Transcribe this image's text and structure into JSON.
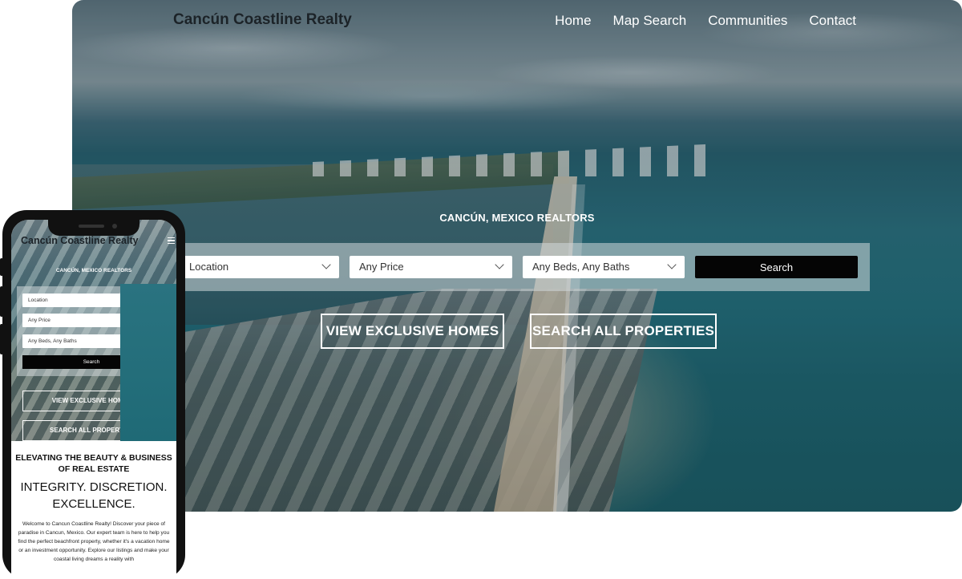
{
  "desktop": {
    "logo": "Cancún Coastline Realty",
    "nav": [
      "Home",
      "Map Search",
      "Communities",
      "Contact"
    ],
    "tagline": "CANCÚN, MEXICO REALTORS",
    "search": {
      "location": "Location",
      "price": "Any Price",
      "beds_baths": "Any Beds, Any Baths",
      "button": "Search"
    },
    "cta_exclusive": "VIEW EXCLUSIVE HOMES",
    "cta_all": "SEARCH ALL PROPERTIES"
  },
  "mobile": {
    "logo": "Cancún Coastline Realty",
    "tagline": "CANCÚN, MEXICO REALTORS",
    "search": {
      "location": "Location",
      "price": "Any Price",
      "beds_baths": "Any Beds, Any Baths",
      "button": "Search"
    },
    "cta_exclusive": "VIEW EXCLUSIVE HOMES",
    "cta_all": "SEARCH ALL PROPERTIES",
    "heading": "ELEVATING THE BEAUTY & BUSINESS OF REAL ESTATE",
    "subheading": "INTEGRITY. DISCRETION. EXCELLENCE.",
    "intro": "Welcome to Cancun Coastline Realty! Discover your piece of paradise in Cancun, Mexico. Our expert team is here to help you find the perfect beachfront property, whether it's a vacation home or an investment opportunity. Explore our listings and make your coastal living dreams a reality with"
  },
  "icons": {
    "menu": "hamburger-menu-icon",
    "dropdown": "chevron-down-icon"
  }
}
